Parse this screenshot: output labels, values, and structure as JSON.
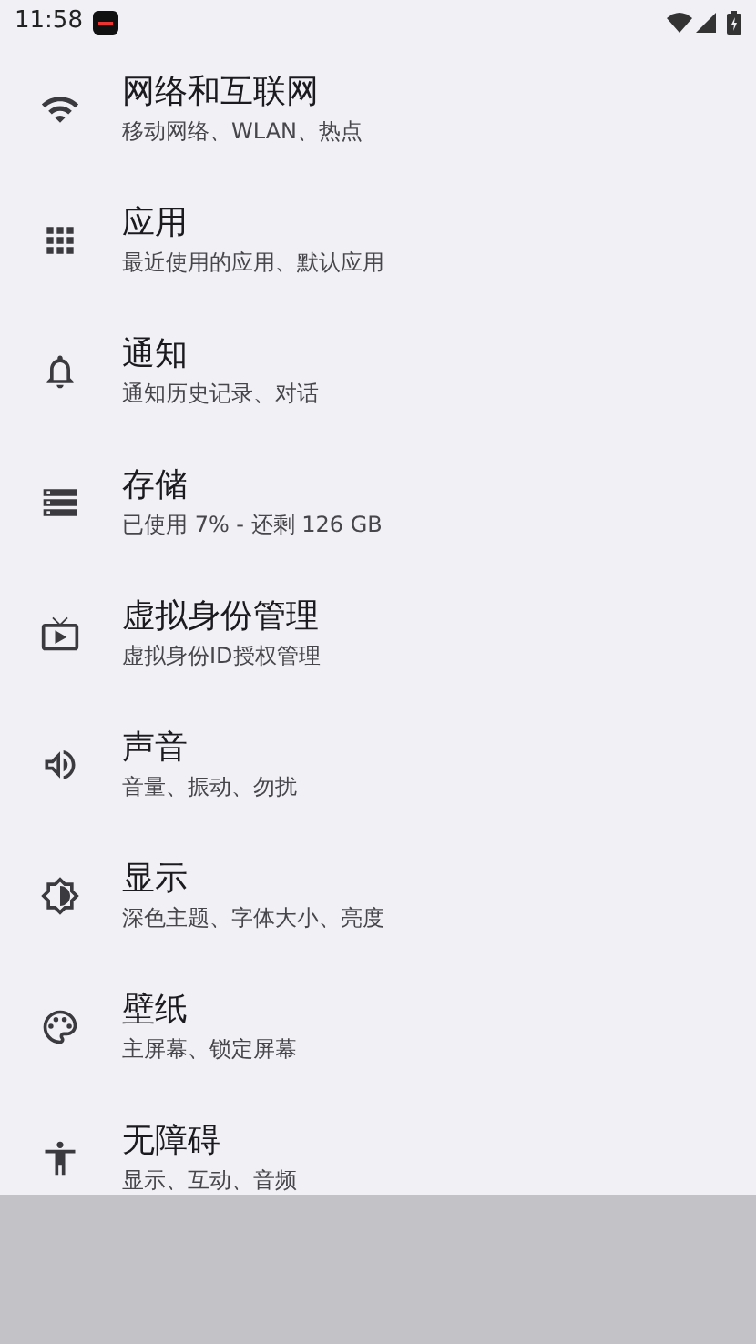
{
  "status_bar": {
    "time": "11:58"
  },
  "settings": [
    {
      "title": "网络和互联网",
      "subtitle": "移动网络、WLAN、热点"
    },
    {
      "title": "应用",
      "subtitle": "最近使用的应用、默认应用"
    },
    {
      "title": "通知",
      "subtitle": "通知历史记录、对话"
    },
    {
      "title": "存储",
      "subtitle": "已使用 7% - 还剩 126 GB"
    },
    {
      "title": "虚拟身份管理",
      "subtitle": "虚拟身份ID授权管理"
    },
    {
      "title": "声音",
      "subtitle": "音量、振动、勿扰"
    },
    {
      "title": "显示",
      "subtitle": "深色主题、字体大小、亮度"
    },
    {
      "title": "壁纸",
      "subtitle": "主屏幕、锁定屏幕"
    },
    {
      "title": "无障碍",
      "subtitle": "显示、互动、音频"
    }
  ]
}
